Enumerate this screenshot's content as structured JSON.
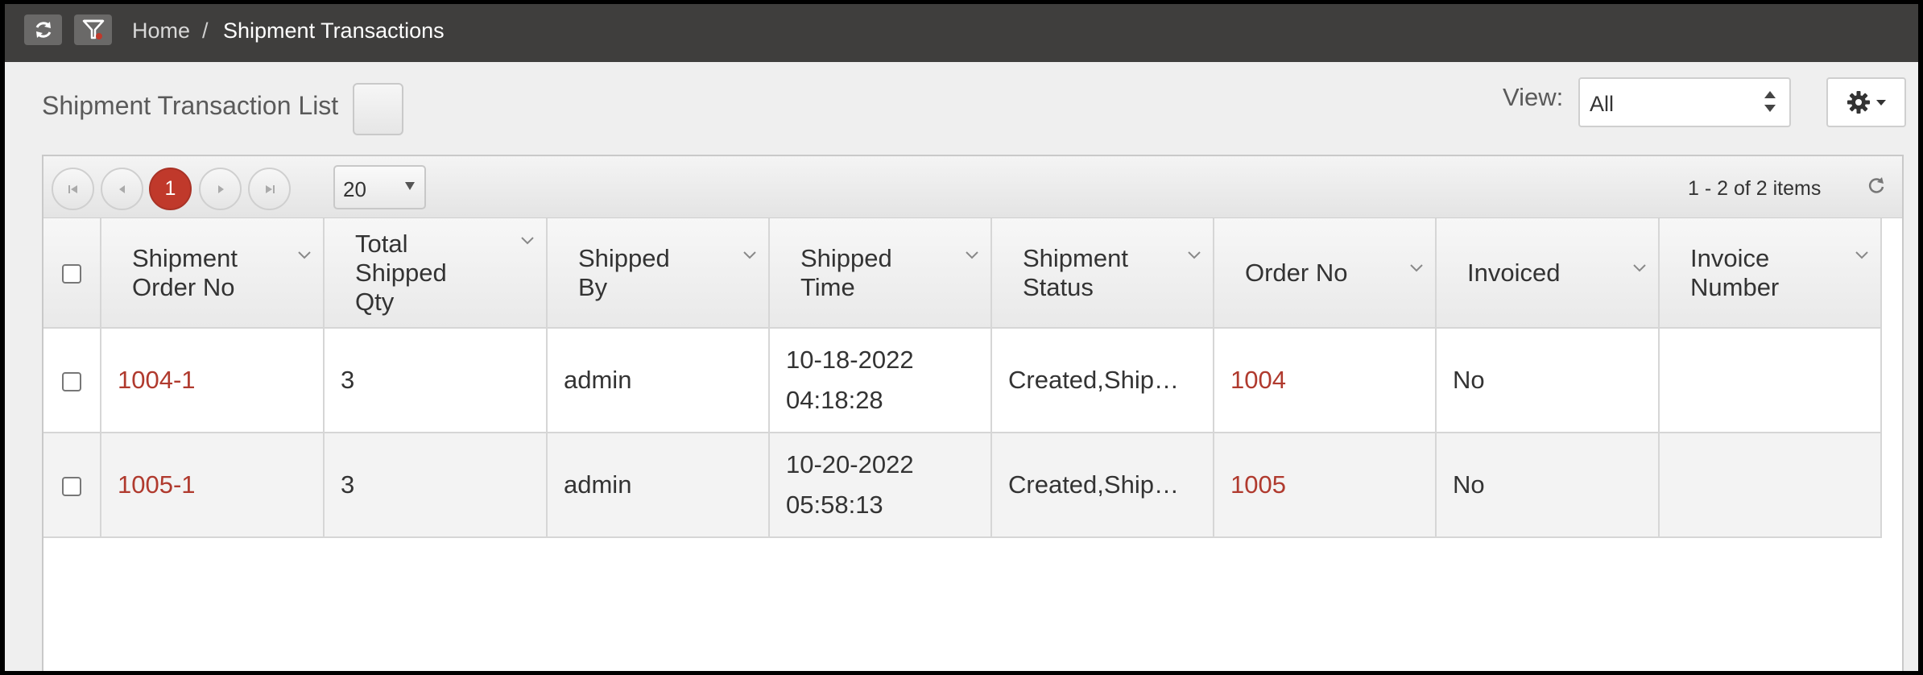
{
  "breadcrumb": {
    "home": "Home",
    "separator": "/",
    "current": "Shipment Transactions"
  },
  "toolbar": {
    "refresh_icon": "refresh-icon",
    "filter_icon": "filter-icon"
  },
  "header": {
    "title": "Shipment Transaction List",
    "view_label": "View:",
    "view_value": "All",
    "settings_icon": "gear-icon"
  },
  "pager": {
    "current_page": "1",
    "page_size": "20",
    "items_info": "1 - 2 of 2 items"
  },
  "columns": [
    "Shipment Order No",
    "Total Shipped Qty",
    "Shipped By",
    "Shipped Time",
    "Shipment Status",
    "Order No",
    "Invoiced",
    "Invoice Number"
  ],
  "rows": [
    {
      "shipment_order_no": "1004-1",
      "total_shipped_qty": "3",
      "shipped_by": "admin",
      "shipped_date": "10-18-2022",
      "shipped_clock": "04:18:28",
      "shipment_status": "Created,Ship…",
      "order_no": "1004",
      "invoiced": "No",
      "invoice_number": ""
    },
    {
      "shipment_order_no": "1005-1",
      "total_shipped_qty": "3",
      "shipped_by": "admin",
      "shipped_date": "10-20-2022",
      "shipped_clock": "05:58:13",
      "shipment_status": "Created,Ship…",
      "order_no": "1005",
      "invoiced": "No",
      "invoice_number": ""
    }
  ],
  "colors": {
    "topbar": "#3f3e3d",
    "accent": "#c0392b",
    "link": "#b03a2e"
  }
}
